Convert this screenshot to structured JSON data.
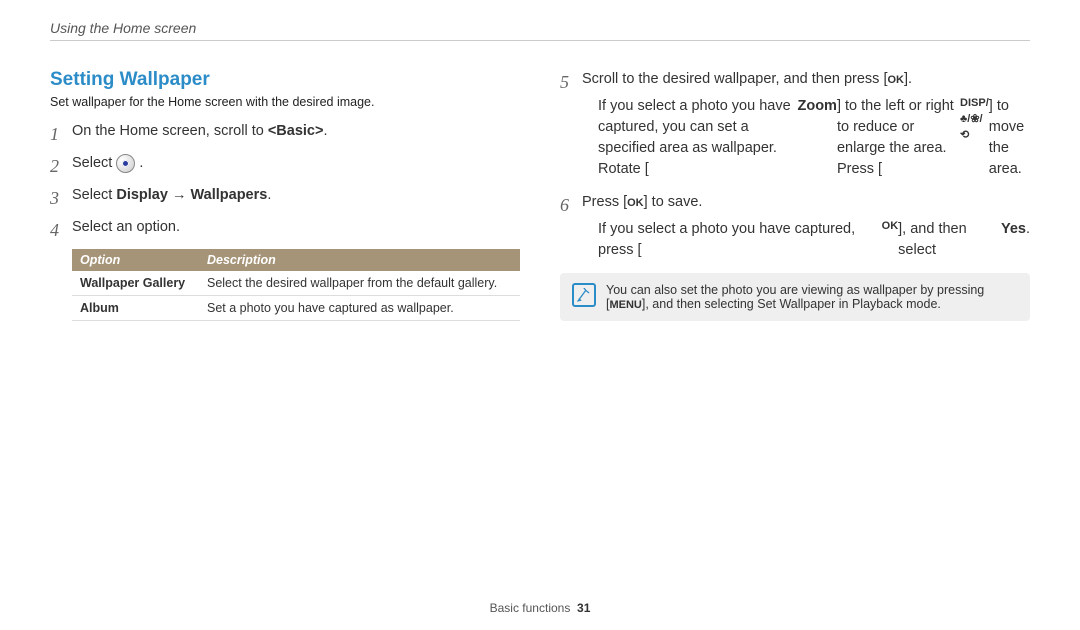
{
  "breadcrumb": "Using the Home screen",
  "section_title": "Setting Wallpaper",
  "intro": "Set wallpaper for the Home screen with the desired image.",
  "steps_left": {
    "s1_pre": "On the Home screen, scroll to ",
    "s1_bold": "<Basic>",
    "s1_post": ".",
    "s2_pre": "Select ",
    "s2_icon_name": "settings-icon",
    "s2_post": " .",
    "s3_pre": "Select ",
    "s3_b1": "Display",
    "s3_arrow": " → ",
    "s3_b2": "Wallpapers",
    "s3_post": ".",
    "s4": "Select an option."
  },
  "table": {
    "h1": "Option",
    "h2": "Description",
    "r1c1": "Wallpaper Gallery",
    "r1c2": "Select the desired wallpaper from the default gallery.",
    "r2c1": "Album",
    "r2c2": "Set a photo you have captured as wallpaper."
  },
  "steps_right": {
    "s5_pre": "Scroll to the desired wallpaper, and then press [",
    "s5_key": "OK",
    "s5_post": "].",
    "s5_bullet_a_pre": "If you select a photo you have captured, you can set a specified area as wallpaper. Rotate [",
    "s5_bullet_a_zoom": "Zoom",
    "s5_bullet_a_mid": "] to the left or right to reduce or enlarge the area. Press [",
    "s5_bullet_a_glyphs": "DISP/♣/❀/⟲",
    "s5_bullet_a_post": "] to move the area.",
    "s6_pre": "Press [",
    "s6_key": "OK",
    "s6_post": "] to save.",
    "s6_bullet_pre": "If you select a photo you have captured, press [",
    "s6_bullet_key": "OK",
    "s6_bullet_mid": "], and then select ",
    "s6_bullet_yes": "Yes",
    "s6_bullet_post": "."
  },
  "note": {
    "pre": "You can also set the photo you are viewing as wallpaper by pressing [",
    "menu": "MENU",
    "mid": "], and then selecting ",
    "bold": "Set Wallpaper",
    "post": " in Playback mode."
  },
  "footer": {
    "section": "Basic functions",
    "page": "31"
  }
}
